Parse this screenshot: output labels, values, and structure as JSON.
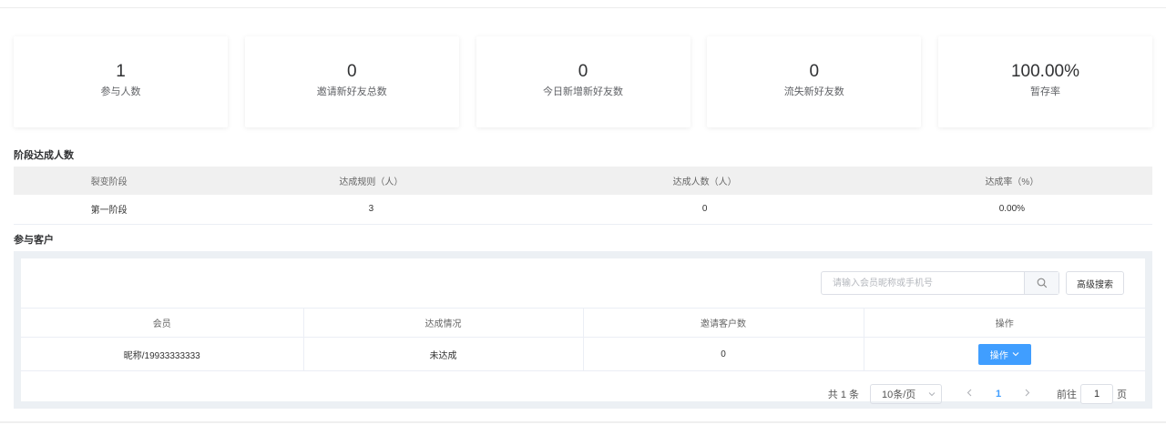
{
  "stats": [
    {
      "value": "1",
      "label": "参与人数"
    },
    {
      "value": "0",
      "label": "邀请新好友总数"
    },
    {
      "value": "0",
      "label": "今日新增新好友数"
    },
    {
      "value": "0",
      "label": "流失新好友数"
    },
    {
      "value": "100.00%",
      "label": "暂存率"
    }
  ],
  "stage_section": {
    "title": "阶段达成人数",
    "columns": [
      "裂变阶段",
      "达成规则（人）",
      "达成人数（人）",
      "达成率（%）"
    ],
    "rows": [
      [
        "第一阶段",
        "3",
        "0",
        "0.00%"
      ]
    ]
  },
  "customer_section": {
    "title": "参与客户",
    "search": {
      "placeholder": "请输入会员昵称或手机号",
      "value": ""
    },
    "advanced_search_label": "高级搜索",
    "columns": [
      "会员",
      "达成情况",
      "邀请客户数",
      "操作"
    ],
    "rows": [
      {
        "member": "昵称/19933333333",
        "status": "未达成",
        "invited": "0",
        "action_label": "操作"
      }
    ],
    "pagination": {
      "total_text": "共 1 条",
      "page_size": "10条/页",
      "current_page": "1",
      "goto_prefix": "前往",
      "goto_value": "1",
      "goto_suffix": "页"
    }
  },
  "colors": {
    "primary": "#409eff",
    "header_bg": "#f0f0f0",
    "panel_bg": "#ecf0f4"
  },
  "icons": [
    "search-icon",
    "chevron-down-icon",
    "chevron-left-icon",
    "chevron-right-icon"
  ]
}
